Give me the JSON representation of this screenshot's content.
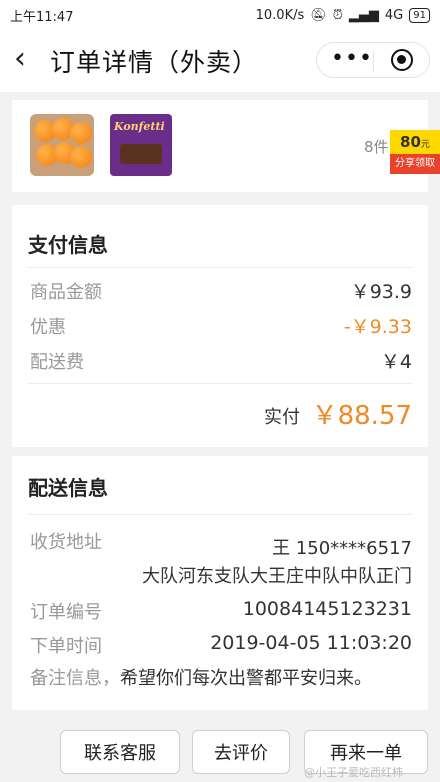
{
  "status_bar": {
    "time": "上午11:47",
    "network_speed": "10.0K/s",
    "signal": "4G",
    "battery": "91"
  },
  "nav": {
    "title": "订单详情（外卖）",
    "more_icon": "more-dots-icon",
    "close_icon": "target-close-icon"
  },
  "goods": {
    "count_text": "8件",
    "share_badge": {
      "amount": "80",
      "unit": "元",
      "label": "分享领取"
    },
    "candy_brand": "Konfetti"
  },
  "payment": {
    "title": "支付信息",
    "rows": [
      {
        "label": "商品金额",
        "value": "￥93.9"
      },
      {
        "label": "优惠",
        "value": "-￥9.33"
      },
      {
        "label": "配送费",
        "value": "￥4"
      }
    ],
    "total_label": "实付",
    "total_value": "￥88.57"
  },
  "shipping": {
    "title": "配送信息",
    "address_label": "收货地址",
    "address_name_phone": "王 150****6517",
    "address_detail": "大队河东支队大王庄中队中队正门",
    "order_no_label": "订单编号",
    "order_no": "10084145123231",
    "order_time_label": "下单时间",
    "order_time": "2019-04-05 11:03:20",
    "remark_label": "备注信息，",
    "remark_value": "希望你们每次出警都平安归来。"
  },
  "actions": {
    "contact": "联系客服",
    "review": "去评价",
    "reorder": "再来一单"
  },
  "watermark": "@小王子爱吃西红柿"
}
